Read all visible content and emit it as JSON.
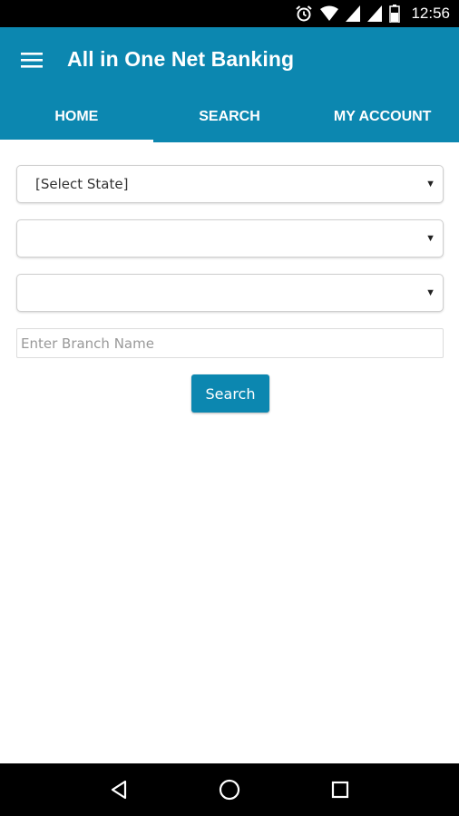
{
  "status_bar": {
    "time": "12:56",
    "icons": [
      "alarm-icon",
      "wifi-icon",
      "signal-icon",
      "signal-icon",
      "battery-icon"
    ]
  },
  "app_bar": {
    "title": "All in One Net Banking",
    "menu_icon": "hamburger-menu-icon",
    "color": "#0c87b0"
  },
  "tabs": [
    {
      "label": "HOME",
      "active": true
    },
    {
      "label": "SEARCH",
      "active": false
    },
    {
      "label": "MY ACCOUNT",
      "active": false
    }
  ],
  "form": {
    "state_select": {
      "value": "[Select State]"
    },
    "district_select": {
      "value": ""
    },
    "city_select": {
      "value": ""
    },
    "branch_input": {
      "placeholder": "Enter Branch Name",
      "value": ""
    },
    "search_label": "Search"
  },
  "nav_bar": {
    "icons": [
      "back-icon",
      "home-icon",
      "recents-icon"
    ]
  }
}
